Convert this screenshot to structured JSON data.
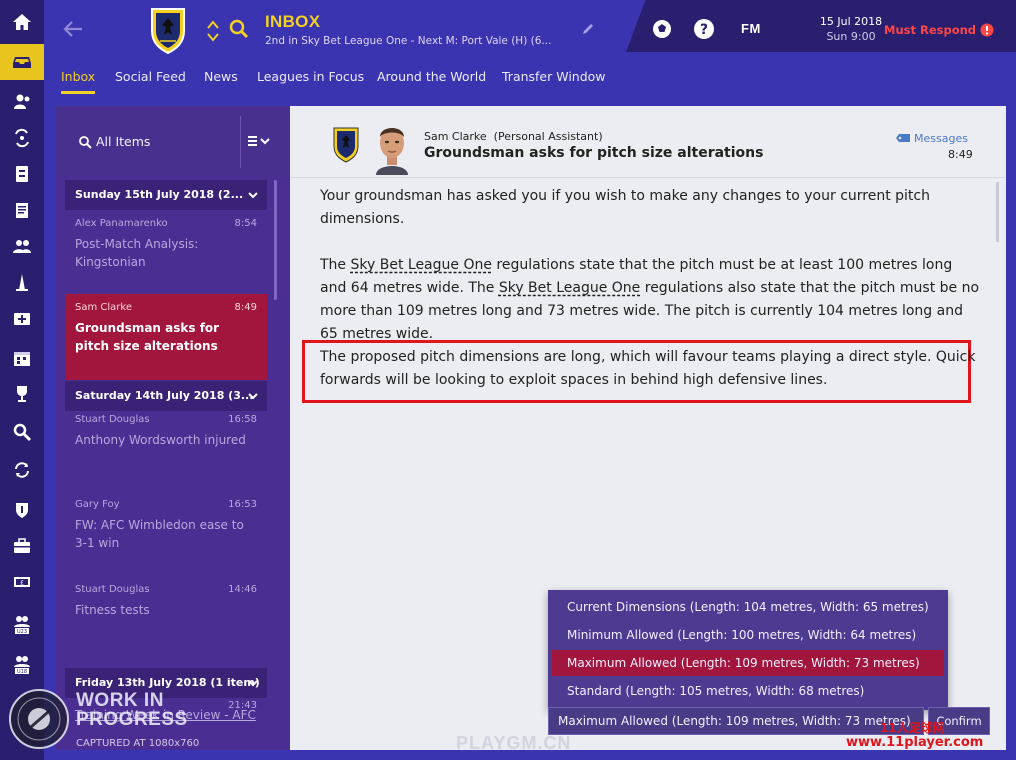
{
  "header": {
    "title": "INBOX",
    "subtitle": "2nd in Sky Bet League One - Next M: Port Vale (H) (6...",
    "fm_logo": "FM",
    "date": "15 Jul 2018",
    "time": "Sun 9:00",
    "must_respond": "Must Respond"
  },
  "tabs": [
    {
      "label": "Inbox"
    },
    {
      "label": "Social Feed"
    },
    {
      "label": "News"
    },
    {
      "label": "Leagues in Focus"
    },
    {
      "label": "Around the World"
    },
    {
      "label": "Transfer Window"
    }
  ],
  "list": {
    "filter_label": "All Items",
    "groups": [
      {
        "label": "Sunday 15th July 2018 (2..."
      },
      {
        "label": "Saturday 14th July 2018 (3..."
      },
      {
        "label": "Friday 13th July 2018 (1 item)"
      }
    ],
    "messages": [
      {
        "from": "Alex Panamarenko",
        "time": "8:54",
        "subject": "Post-Match Analysis: Kingstonian"
      },
      {
        "from": "Sam Clarke",
        "time": "8:49",
        "subject": "Groundsman asks for pitch size alterations"
      },
      {
        "from": "Stuart Douglas",
        "time": "16:58",
        "subject": "Anthony Wordsworth injured"
      },
      {
        "from": "Gary Foy",
        "time": "16:53",
        "subject": "FW: AFC Wimbledon ease to 3-1 win"
      },
      {
        "from": "Stuart Douglas",
        "time": "14:46",
        "subject": "Fitness tests"
      },
      {
        "from": "",
        "time": "21:43",
        "subject": "Training Week in Review - AFC"
      }
    ]
  },
  "message": {
    "sender": "Sam Clarke  (Personal Assistant)",
    "subject": "Groundsman asks for pitch size alterations",
    "messages_link": "Messages",
    "time": "8:49",
    "p1": "Your groundsman has asked you if you wish to make any changes to your current pitch dimensions.",
    "p2_a": "The ",
    "p2_link1": "Sky Bet League One",
    "p2_b": " regulations state that the pitch must be at least 100 metres long and 64 metres wide. The ",
    "p2_link2": "Sky Bet League One",
    "p2_c": " regulations also state that the pitch must be no more than 109 metres long and 73 metres wide. The pitch is currently 104 metres long and 65 metres wide.",
    "p3": "The proposed pitch dimensions are long, which will favour teams playing a direct style. Quick forwards will be looking to exploit spaces in behind high defensive lines."
  },
  "dropdown": {
    "options": [
      "Current Dimensions (Length: 104 metres, Width: 65 metres)",
      "Minimum Allowed (Length: 100 metres, Width: 64 metres)",
      "Maximum Allowed (Length: 109 metres, Width: 73 metres)",
      "Standard (Length: 105 metres, Width: 68 metres)"
    ],
    "selected_index": 2,
    "selected_value": "Maximum Allowed (Length: 109 metres, Width: 73 metres)",
    "confirm_label": "Confirm"
  },
  "overlays": {
    "wip_line1": "WORK IN",
    "wip_line2": "PROGRESS",
    "wip_line3": "CAPTURED AT 1080x760",
    "watermark_playgm": "PLAYGM.CN",
    "watermark_cn": "11人足球网",
    "watermark_url": "www.11player.com"
  },
  "colors": {
    "accent": "#f2d024",
    "selected": "#a2163e",
    "highlight": "#e0141b",
    "header_bg": "#3a34b0",
    "rail_bg": "#2a1f6e"
  },
  "icons": {
    "rail": [
      "home-icon",
      "inbox-icon",
      "squad-icon",
      "tactics-icon",
      "data-icon",
      "reports-icon",
      "staff-icon",
      "training-icon",
      "medical-icon",
      "schedule-icon",
      "competitions-icon",
      "scouting-icon",
      "transfers-icon",
      "club-vision-icon",
      "finances-icon",
      "cash-icon",
      "u23-icon",
      "u18-icon"
    ]
  }
}
